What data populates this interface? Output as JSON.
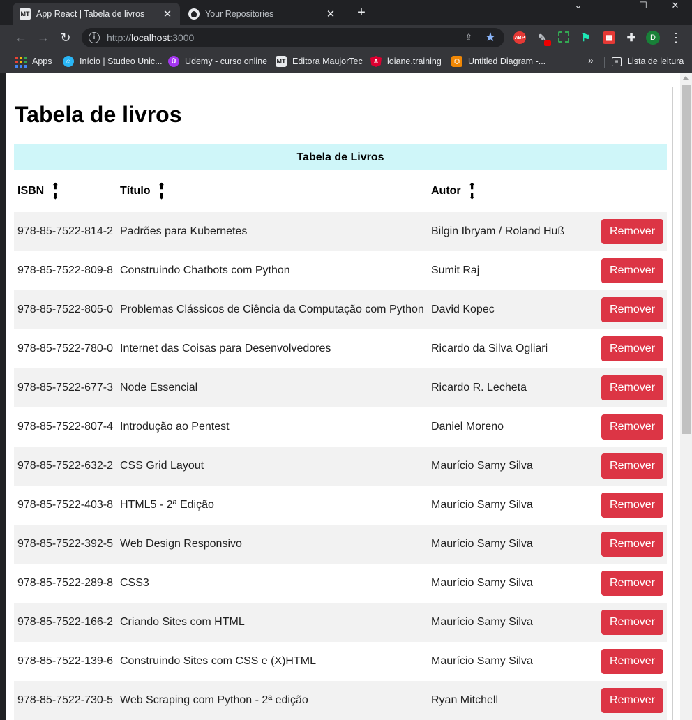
{
  "browser": {
    "tabs": [
      {
        "favicon": "MT",
        "title": "App React | Tabela de livros",
        "active": true
      },
      {
        "favicon": "github-icon",
        "title": "Your Repositories",
        "active": false
      }
    ],
    "url_scheme": "http://",
    "url_host": "localhost",
    "url_port": ":3000",
    "extensions": {
      "abp_label": "ABP",
      "grid_label": "▦"
    },
    "profile_initial": "D",
    "bookmarks": [
      {
        "label": "Apps",
        "icon": "apps-grid-icon"
      },
      {
        "label": "Início | Studeo Unic...",
        "icon": "studeo-icon"
      },
      {
        "label": "Udemy - curso online",
        "icon": "udemy-icon"
      },
      {
        "label": "Editora MaujorTec",
        "icon": "mt-icon"
      },
      {
        "label": "loiane.training",
        "icon": "angular-icon"
      },
      {
        "label": "Untitled Diagram -...",
        "icon": "drawio-icon"
      }
    ],
    "reading_list_label": "Lista de leitura",
    "colors": {
      "accent": "#8ab4f8",
      "profile": "#188038"
    }
  },
  "page": {
    "title": "Tabela de livros",
    "caption": "Tabela de Livros",
    "headers": {
      "isbn": "ISBN",
      "titulo": "Título",
      "autor": "Autor"
    },
    "remove_label": "Remover",
    "colors": {
      "caption_bg": "#cff6f9",
      "remove_button": "#dc3545",
      "striped_row": "#f2f2f2"
    },
    "rows": [
      {
        "isbn": "978-85-7522-814-2",
        "titulo": "Padrões para Kubernetes",
        "autor": "Bilgin Ibryam / Roland Huß"
      },
      {
        "isbn": "978-85-7522-809-8",
        "titulo": "Construindo Chatbots com Python",
        "autor": "Sumit Raj"
      },
      {
        "isbn": "978-85-7522-805-0",
        "titulo": "Problemas Clássicos de Ciência da Computação com Python",
        "autor": "David Kopec"
      },
      {
        "isbn": "978-85-7522-780-0",
        "titulo": "Internet das Coisas para Desenvolvedores",
        "autor": "Ricardo da Silva Ogliari"
      },
      {
        "isbn": "978-85-7522-677-3",
        "titulo": "Node Essencial",
        "autor": "Ricardo R. Lecheta"
      },
      {
        "isbn": "978-85-7522-807-4",
        "titulo": "Introdução ao Pentest",
        "autor": "Daniel Moreno"
      },
      {
        "isbn": "978-85-7522-632-2",
        "titulo": "CSS Grid Layout",
        "autor": "Maurício Samy Silva"
      },
      {
        "isbn": "978-85-7522-403-8",
        "titulo": "HTML5 - 2ª Edição",
        "autor": "Maurício Samy Silva"
      },
      {
        "isbn": "978-85-7522-392-5",
        "titulo": "Web Design Responsivo",
        "autor": "Maurício Samy Silva"
      },
      {
        "isbn": "978-85-7522-289-8",
        "titulo": "CSS3",
        "autor": "Maurício Samy Silva"
      },
      {
        "isbn": "978-85-7522-166-2",
        "titulo": "Criando Sites com HTML",
        "autor": "Maurício Samy Silva"
      },
      {
        "isbn": "978-85-7522-139-6",
        "titulo": "Construindo Sites com CSS e (X)HTML",
        "autor": "Maurício Samy Silva"
      },
      {
        "isbn": "978-85-7522-730-5",
        "titulo": "Web Scraping com Python - 2ª edição",
        "autor": "Ryan Mitchell"
      }
    ]
  }
}
